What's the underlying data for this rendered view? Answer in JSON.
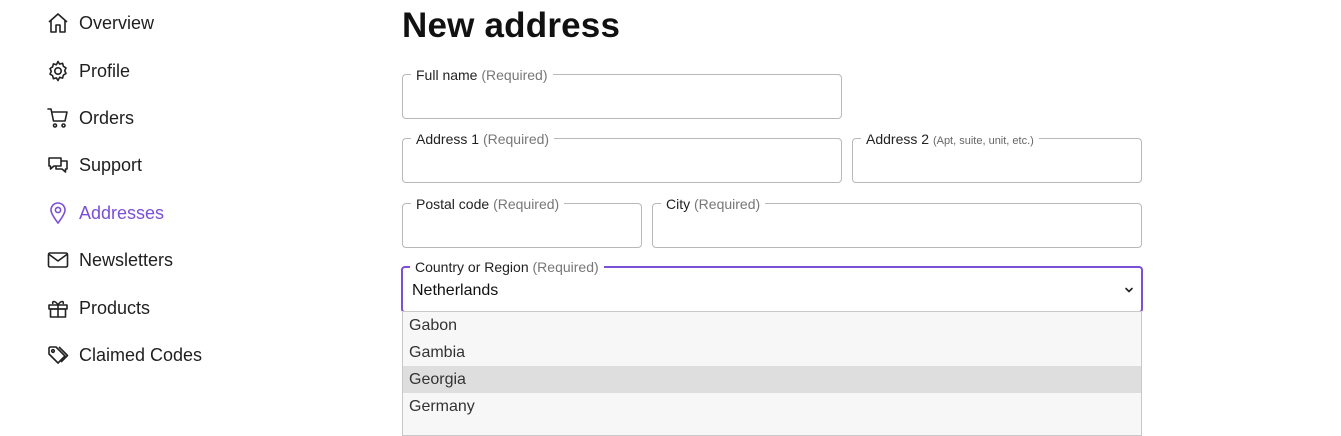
{
  "sidebar": {
    "items": [
      {
        "label": "Overview",
        "icon": "home-icon"
      },
      {
        "label": "Profile",
        "icon": "gear-icon"
      },
      {
        "label": "Orders",
        "icon": "cart-icon"
      },
      {
        "label": "Support",
        "icon": "chat-icon"
      },
      {
        "label": "Addresses",
        "icon": "location-pin-icon",
        "active": true
      },
      {
        "label": "Newsletters",
        "icon": "mail-icon"
      },
      {
        "label": "Products",
        "icon": "gift-box-icon"
      },
      {
        "label": "Claimed Codes",
        "icon": "tag-icon"
      }
    ]
  },
  "page": {
    "title": "New address"
  },
  "form": {
    "full_name": {
      "label": "Full name",
      "required": "(Required)",
      "value": ""
    },
    "address1": {
      "label": "Address 1",
      "required": "(Required)",
      "value": ""
    },
    "address2": {
      "label": "Address 2",
      "hint": "(Apt, suite, unit, etc.)",
      "value": ""
    },
    "postal_code": {
      "label": "Postal code",
      "required": "(Required)",
      "value": ""
    },
    "city": {
      "label": "City",
      "required": "(Required)",
      "value": ""
    },
    "country": {
      "label": "Country or Region",
      "required": "(Required)",
      "value": "Netherlands"
    }
  },
  "dropdown": {
    "options": [
      "Gabon",
      "Gambia",
      "Georgia",
      "Germany"
    ],
    "highlighted": "Georgia"
  },
  "colors": {
    "accent": "#7b4fd6",
    "border": "#b8b8b8",
    "highlight": "#dedede"
  }
}
